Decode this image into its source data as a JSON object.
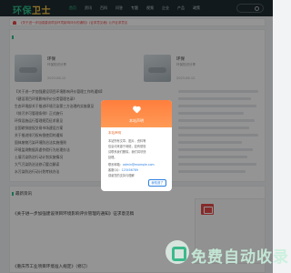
{
  "nav": {
    "logo_main": "环保",
    "logo_accent": "卫士",
    "items": [
      "首页",
      "资讯",
      "百科",
      "问答",
      "专题",
      "视频",
      "企业",
      "产品",
      "政策"
    ]
  },
  "notice": {
    "text": "《关于进一步加强建设项目环境影响评价的通知》(征求意见稿) 公开征求意见"
  },
  "panel_top": {
    "cards": [
      {
        "title": "环保",
        "meta": "环保知识分享",
        "date": "2023-06-12"
      },
      {
        "title": "环保",
        "meta": "环保知识分享",
        "date": "2023-06-12"
      }
    ]
  },
  "list_left": [
    "【关于进一步加强建设项目环境影响评价管理工作的通知】",
    "《建设项目环境影响评价分类管理名录》",
    "生态环境部关于推进环境污染第三方治理的实施意见",
    "《排污许可管理条例》正式施行",
    "环保设施运行管理规范征求意见",
    "全国碳排放权交易市场建设方案",
    "关于推进排污权有偿使用的通知",
    "固体废物污染环境防治法实施细则",
    "环境监测数据弄虚作假行为处理办法",
    "土壤污染防治行动计划实施情况",
    "大气污染防治法修订要点解读",
    "水污染防治行动计划考核办法"
  ],
  "panel_bottom": {
    "title": "最新资讯",
    "article_1": "《关于进一步加强建设项目环境影响评价管理的通知》征求意见稿",
    "article_2": "《重庆市工业项目环境准入规定》（修订）"
  },
  "modal": {
    "header": "本站声明",
    "subtitle": "本站声明",
    "lines": [
      "本站所有文章、图片、资料等",
      "信息均来源于网络，如有侵权",
      "请联系我们删除，我们将尽快",
      "处理。",
      "联系邮箱：",
      "客服QQ：",
      "感谢您的支持与理解"
    ],
    "email": "admin@example.com",
    "qq": "123456789",
    "button": "我知道了"
  },
  "watermark": {
    "text": "免费自动收录"
  },
  "colors": {
    "brand": "#2cc18a",
    "modal_header": "#ff8a45",
    "link": "#2b7fe0",
    "nav_bg": "#1f2c31"
  }
}
